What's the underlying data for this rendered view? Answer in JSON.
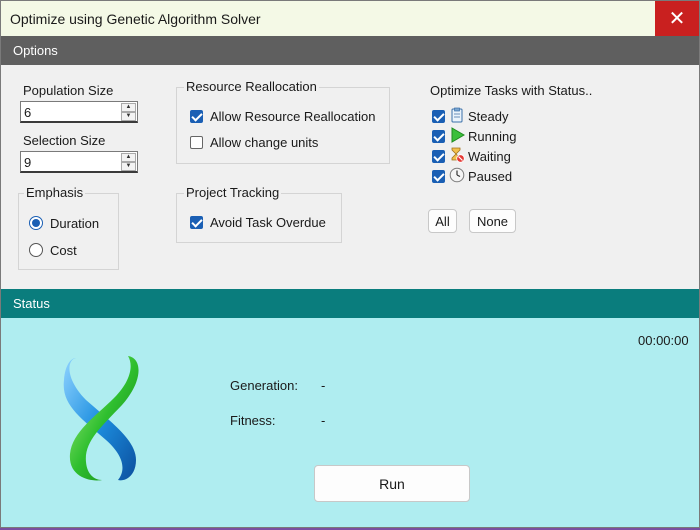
{
  "window": {
    "title": "Optimize using Genetic Algorithm Solver",
    "close_glyph": "✕"
  },
  "options": {
    "header": "Options",
    "population": {
      "label": "Population Size",
      "value": "6"
    },
    "selection": {
      "label": "Selection Size",
      "value": "9"
    },
    "emphasis": {
      "title": "Emphasis",
      "duration": {
        "label": "Duration",
        "checked": true
      },
      "cost": {
        "label": "Cost",
        "checked": false
      }
    },
    "resource": {
      "title": "Resource Reallocation",
      "allow_reallocation": {
        "label": "Allow Resource Reallocation",
        "checked": true
      },
      "allow_change_units": {
        "label": "Allow change units",
        "checked": false
      }
    },
    "tracking": {
      "title": "Project Tracking",
      "avoid_overdue": {
        "label": "Avoid Task Overdue",
        "checked": true
      }
    },
    "tasks": {
      "title": "Optimize Tasks with Status..",
      "steady": {
        "label": "Steady",
        "icon": "clipboard-icon"
      },
      "running": {
        "label": "Running",
        "icon": "play-icon"
      },
      "waiting": {
        "label": "Waiting",
        "icon": "hourglass-icon"
      },
      "paused": {
        "label": "Paused",
        "icon": "clock-icon"
      },
      "all_label": "All",
      "none_label": "None"
    }
  },
  "status": {
    "header": "Status",
    "timer": "00:00:00",
    "generation_label": "Generation:",
    "generation_value": "-",
    "fitness_label": "Fitness:",
    "fitness_value": "-",
    "run_label": "Run",
    "logo_icon": "dna-helix-icon"
  },
  "colors": {
    "status_header": "#0a7d7d",
    "status_bg": "#afedf0",
    "accent": "#1a5fb4"
  }
}
